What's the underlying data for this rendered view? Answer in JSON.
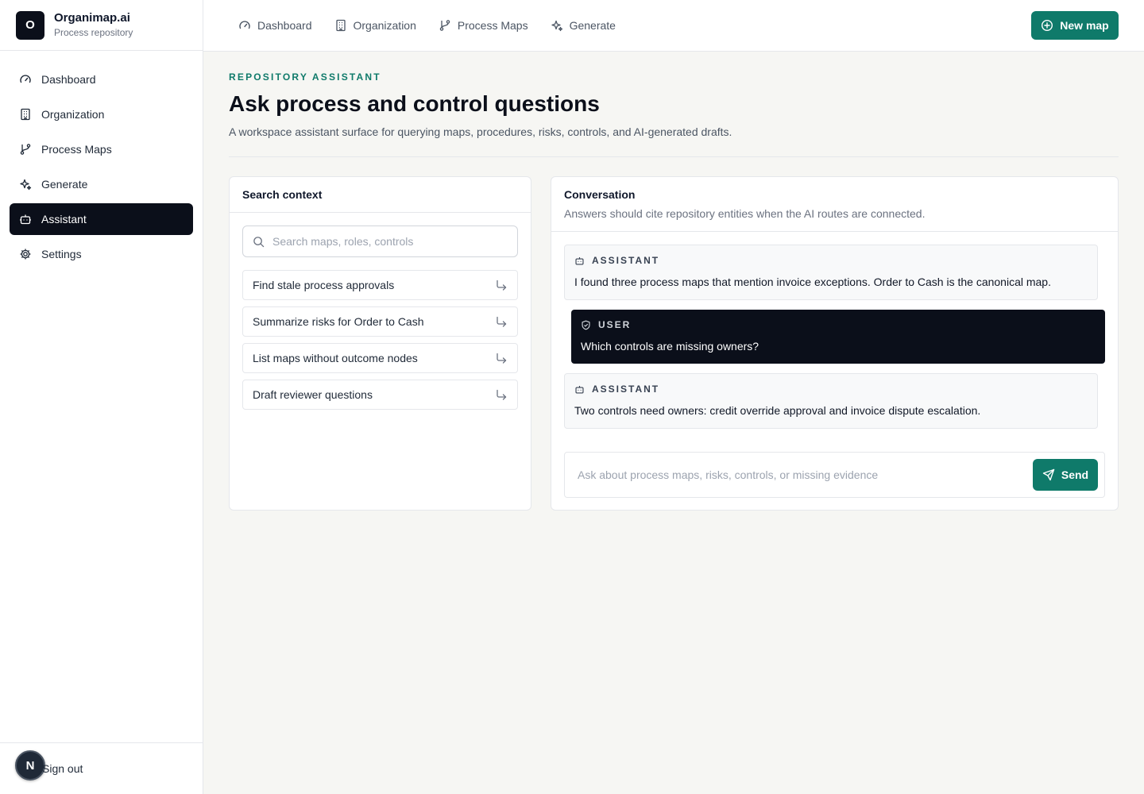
{
  "brand": {
    "logo_letter": "O",
    "name": "Organimap.ai",
    "subtitle": "Process repository"
  },
  "sidebar": {
    "items": [
      {
        "label": "Dashboard",
        "icon": "gauge-icon",
        "active": false
      },
      {
        "label": "Organization",
        "icon": "building-icon",
        "active": false
      },
      {
        "label": "Process Maps",
        "icon": "git-branch-icon",
        "active": false
      },
      {
        "label": "Generate",
        "icon": "sparkles-icon",
        "active": false
      },
      {
        "label": "Assistant",
        "icon": "bot-icon",
        "active": true
      },
      {
        "label": "Settings",
        "icon": "gear-icon",
        "active": false
      }
    ],
    "footer": {
      "avatar_letter": "N",
      "signout_label": "Sign out"
    }
  },
  "topbar": {
    "links": [
      {
        "label": "Dashboard",
        "icon": "gauge-icon"
      },
      {
        "label": "Organization",
        "icon": "building-icon"
      },
      {
        "label": "Process Maps",
        "icon": "git-branch-icon"
      },
      {
        "label": "Generate",
        "icon": "sparkles-icon"
      }
    ],
    "new_map_label": "New map"
  },
  "page": {
    "eyebrow": "REPOSITORY ASSISTANT",
    "title": "Ask process and control questions",
    "subtitle": "A workspace assistant surface for querying maps, procedures, risks, controls, and AI-generated drafts."
  },
  "search_panel": {
    "title": "Search context",
    "search_placeholder": "Search maps, roles, controls",
    "suggestions": [
      "Find stale process approvals",
      "Summarize risks for Order to Cash",
      "List maps without outcome nodes",
      "Draft reviewer questions"
    ]
  },
  "conversation": {
    "title": "Conversation",
    "description": "Answers should cite repository entities when the AI routes are connected.",
    "messages": [
      {
        "role": "ASSISTANT",
        "text": "I found three process maps that mention invoice exceptions. Order to Cash is the canonical map."
      },
      {
        "role": "USER",
        "text": "Which controls are missing owners?"
      },
      {
        "role": "ASSISTANT",
        "text": "Two controls need owners: credit override approval and invoice dispute escalation."
      }
    ],
    "composer_placeholder": "Ask about process maps, risks, controls, or missing evidence",
    "send_label": "Send"
  },
  "colors": {
    "accent": "#0f7a6a",
    "dark": "#0b0f1a",
    "background": "#f6f6f3"
  }
}
